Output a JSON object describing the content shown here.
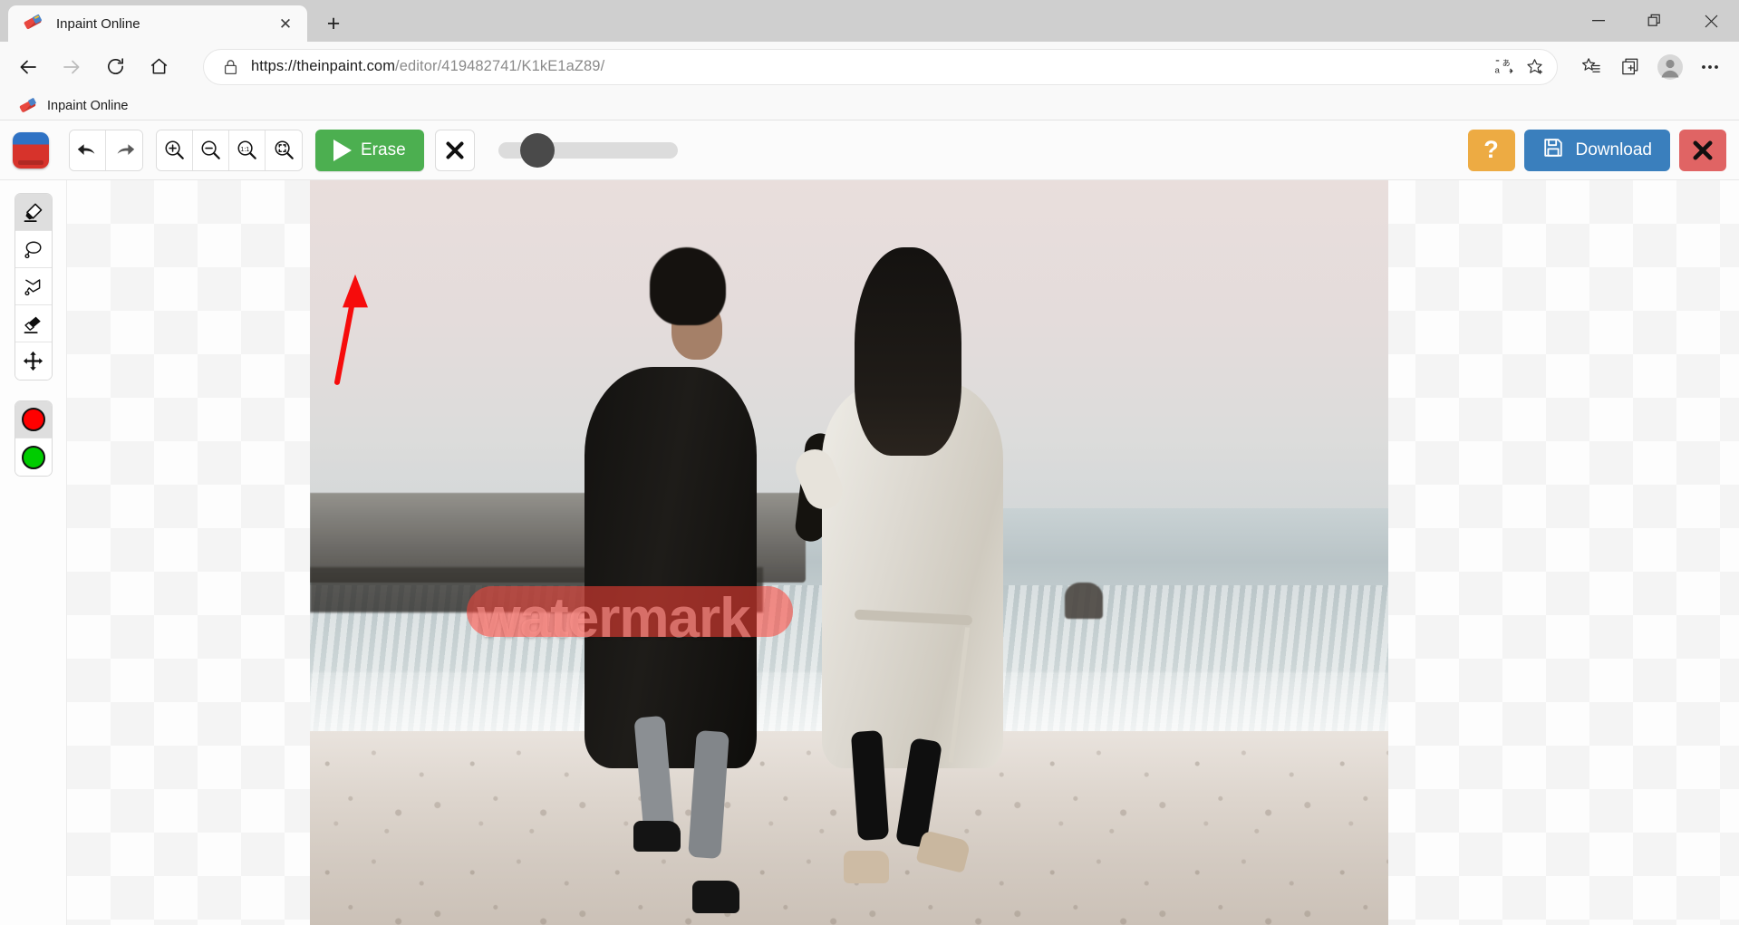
{
  "browser": {
    "tab": {
      "title": "Inpaint Online",
      "favicon": "inpaint-eraser-icon",
      "close_label": "✕"
    },
    "new_tab_label": "+",
    "window_controls": {
      "minimize": "minimize-icon",
      "restore": "restore-icon",
      "close": "close-icon"
    },
    "nav": {
      "back": "back-arrow-icon",
      "forward": "forward-arrow-icon",
      "refresh": "refresh-icon",
      "home": "home-icon"
    },
    "omnibox": {
      "lock": "lock-icon",
      "url_scheme_host": "https://theinpaint.com",
      "url_path": "/editor/419482741/K1kE1aZ89/",
      "full_url": "https://theinpaint.com/editor/419482741/K1kE1aZ89/",
      "translate": "translate-icon",
      "favorite": "star-add-icon"
    },
    "toolbar_icons": {
      "collections_list": "favorites-list-icon",
      "collections": "collections-icon",
      "profile": "profile-avatar-icon",
      "settings": "more-options-icon"
    },
    "bookmarks": [
      {
        "label": "Inpaint Online",
        "icon": "inpaint-eraser-icon"
      }
    ]
  },
  "app": {
    "logo": "inpaint-app-logo",
    "history": [
      {
        "name": "undo",
        "icon": "undo-arrow-icon"
      },
      {
        "name": "redo",
        "icon": "redo-arrow-icon"
      }
    ],
    "zoom_tools": [
      {
        "name": "zoom-in",
        "icon": "magnifier-plus-icon"
      },
      {
        "name": "zoom-out",
        "icon": "magnifier-minus-icon"
      },
      {
        "name": "zoom-actual",
        "icon": "magnifier-1to1-icon",
        "label": "1:1"
      },
      {
        "name": "zoom-fit",
        "icon": "magnifier-fit-icon"
      }
    ],
    "erase_button": {
      "label": "Erase",
      "icon": "play-triangle-icon",
      "color": "#4caf50"
    },
    "clear_button": {
      "icon": "x-mark-icon"
    },
    "brush_slider": {
      "name": "brush-size-slider",
      "value": 22,
      "min": 0,
      "max": 100
    },
    "help_button": {
      "label": "?",
      "color": "#edab43"
    },
    "download_button": {
      "label": "Download",
      "icon": "floppy-disk-icon",
      "color": "#3a7fbd"
    },
    "close_button": {
      "icon": "x-mark-icon",
      "color": "#e06464"
    },
    "tools": [
      {
        "name": "marker-tool",
        "icon": "marker-pen-icon",
        "active": true
      },
      {
        "name": "lasso-tool",
        "icon": "lasso-icon",
        "active": false
      },
      {
        "name": "polygon-lasso-tool",
        "icon": "polygon-lasso-icon",
        "active": false
      },
      {
        "name": "eraser-tool",
        "icon": "eraser-icon",
        "active": false
      },
      {
        "name": "move-tool",
        "icon": "move-arrows-icon",
        "active": false
      }
    ],
    "colors": [
      {
        "name": "color-red",
        "hex": "#ff0000",
        "active": true
      },
      {
        "name": "color-green",
        "hex": "#00cc00",
        "active": false
      }
    ],
    "canvas": {
      "image_alt": "Two people walking on a beach toward the sea at dusk",
      "watermark_text": "watermark",
      "mask_color": "#ff4136",
      "annotation": {
        "type": "arrow",
        "color": "#ff0000",
        "points_to": "Erase"
      }
    }
  }
}
